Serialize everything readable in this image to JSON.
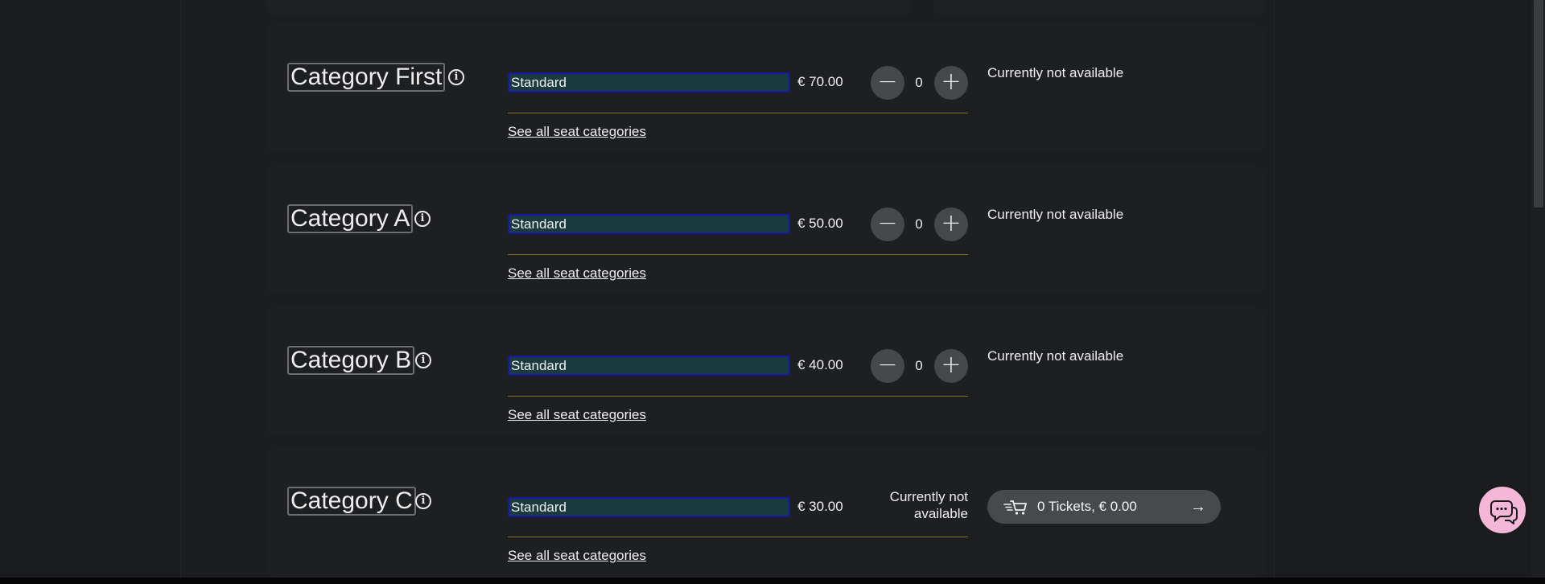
{
  "categories": [
    {
      "title": "Category First",
      "seat_type": "Standard",
      "price": "€ 70.00",
      "quantity": "0",
      "see_all": "See all seat categories",
      "status": "Currently not available"
    },
    {
      "title": "Category A",
      "seat_type": "Standard",
      "price": "€ 50.00",
      "quantity": "0",
      "see_all": "See all seat categories",
      "status": "Currently not available"
    },
    {
      "title": "Category B",
      "seat_type": "Standard",
      "price": "€ 40.00",
      "quantity": "0",
      "see_all": "See all seat categories",
      "status": "Currently not available"
    },
    {
      "title": "Category C",
      "seat_type": "Standard",
      "price": "€ 30.00",
      "see_all": "See all seat categories",
      "status": "Currently not available"
    }
  ],
  "icons": {
    "info": "info-icon",
    "minus": "minus-icon",
    "plus": "plus-icon",
    "cart": "cart-icon",
    "arrow": "arrow-right-icon",
    "chat": "chat-icon"
  },
  "cart": {
    "label": "0 Tickets, € 0.00"
  },
  "colors": {
    "background": "#1b1c1e",
    "select_bg": "#1b3a40",
    "select_border": "#1616a8",
    "divider": "#7d6c2c",
    "chat_button": "#f4b7d8",
    "cart_button": "#474a4d"
  }
}
